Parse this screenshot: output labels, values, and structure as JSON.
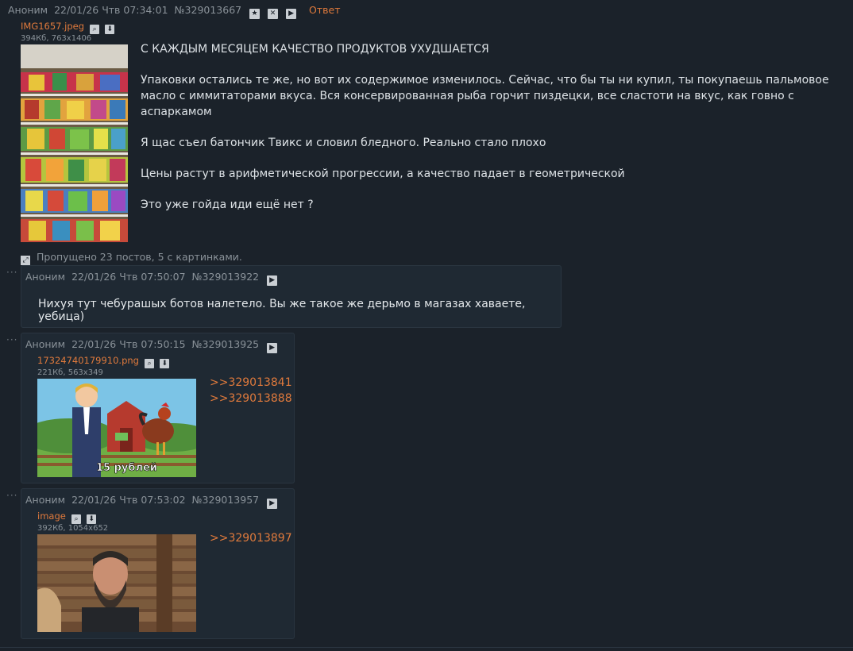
{
  "op": {
    "author": "Аноним",
    "date": "22/01/26 Чтв 07:34:01",
    "num": "№329013667",
    "reply_label": "Ответ",
    "file_name": "IMG1657.jpeg",
    "file_meta": "394Кб, 763x1406",
    "text": [
      "С КАЖДЫМ МЕСЯЦЕМ КАЧЕСТВО ПРОДУКТОВ УХУДШАЕТСЯ",
      "Упаковки остались те же, но вот их содержимое изменилось. Сейчас, что бы ты ни купил, ты покупаешь пальмовое масло с иммитаторами вкуса. Вся консервированная рыба горчит пиздецки, все сластоти на вкус, как говно с аспаркамом",
      "Я щас съел батончик Твикс и словил бледного. Реально стало плохо",
      "Цены растут в арифметической прогрессии, а качество падает в геометрической",
      "Это уже гойда иди ещё нет ?"
    ]
  },
  "skipped": "Пропущено 23 постов, 5 с картинками.",
  "posts": [
    {
      "author": "Аноним",
      "date": "22/01/26 Чтв 07:50:07",
      "num": "№329013922",
      "text": "Нихуя тут чебурашых ботов налетело. Вы же такое же дерьмо в магазах хаваете, уебица)"
    },
    {
      "author": "Аноним",
      "date": "22/01/26 Чтв 07:50:15",
      "num": "№329013925",
      "file_name": "17324740179910.png",
      "file_meta": "221Кб, 563x349",
      "image_caption": "15 рублей",
      "links": [
        ">>329013841",
        ">>329013888"
      ]
    },
    {
      "author": "Аноним",
      "date": "22/01/26 Чтв 07:53:02",
      "num": "№329013957",
      "file_name": "image",
      "file_meta": "392Кб, 1054x652",
      "links": [
        ">>329013897"
      ]
    }
  ],
  "icons": {
    "star": "star-icon",
    "close": "close-icon",
    "play": "play-icon",
    "search": "search-icon",
    "download": "download-icon",
    "expand": "expand-icon",
    "more": "more-dots-icon"
  },
  "colors": {
    "background": "#1b222a",
    "post_background": "#1f2933",
    "accent": "#e07a3c",
    "meta": "#8a9299"
  }
}
